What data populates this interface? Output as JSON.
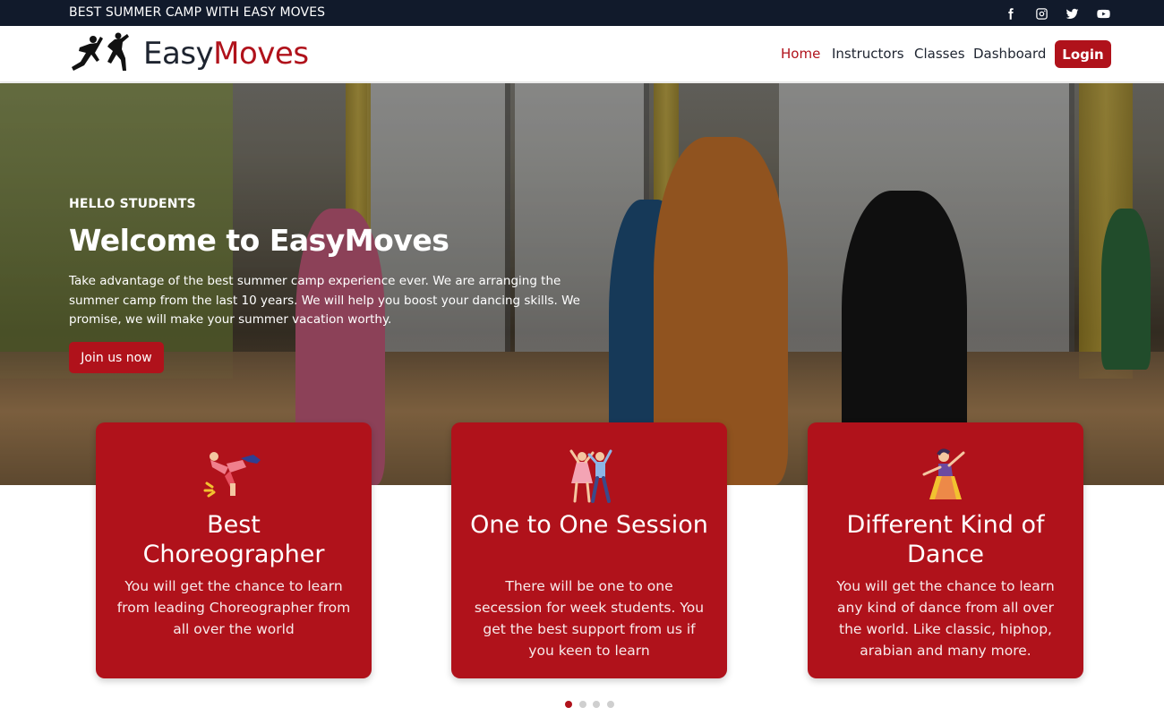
{
  "topbar": {
    "text": "BEST SUMMER CAMP WITH EASY MOVES",
    "social": [
      "facebook-icon",
      "instagram-icon",
      "twitter-icon",
      "youtube-icon"
    ]
  },
  "brand": {
    "part1": "Easy",
    "part2": "Moves"
  },
  "nav": {
    "items": [
      "Home",
      "Instructors",
      "Classes",
      "Dashboard"
    ],
    "active": "Home",
    "login_label": "Login"
  },
  "hero": {
    "kicker": "HELLO STUDENTS",
    "title": "Welcome to EasyMoves",
    "description": "Take advantage of the best summer camp experience ever. We are arranging the summer camp from the last 10 years. We will help you boost your dancing skills. We promise, we will make your summer vacation worthy.",
    "button_label": "Join us now"
  },
  "cards": [
    {
      "icon": "breakdancer-icon",
      "title": "Best Choreographer",
      "text": "You will get the chance to learn from leading Choreographer from all over the world"
    },
    {
      "icon": "dancing-couple-icon",
      "title": "One to One Session",
      "text": "There will be one to one secession for week students. You get the best support from us if you keen to learn"
    },
    {
      "icon": "classic-dancer-icon",
      "title": "Different Kind of Dance",
      "text": "You will get the chance to learn any kind of dance from all over the world. Like classic, hiphop, arabian and many more."
    }
  ],
  "carousel": {
    "count": 4,
    "active_index": 0
  },
  "colors": {
    "brand_red": "#b0121b",
    "topbar_bg": "#111a2b",
    "text_dark": "#1e2430"
  }
}
